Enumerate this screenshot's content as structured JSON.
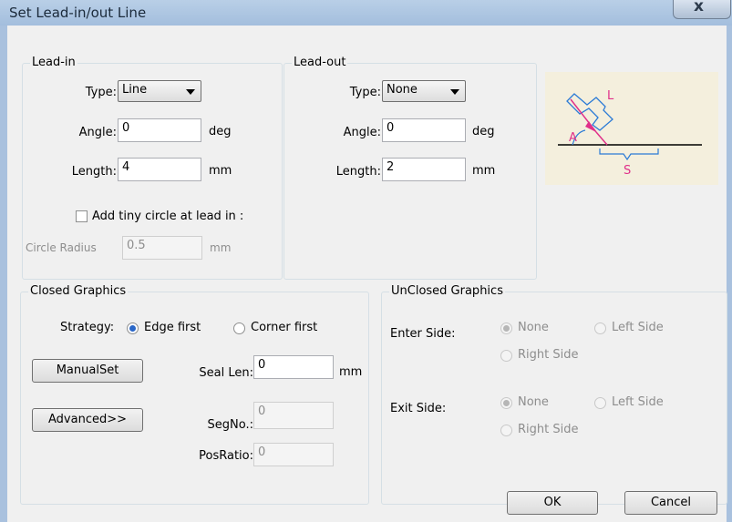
{
  "window": {
    "title": "Set Lead-in/out Line",
    "close_label": "x"
  },
  "lead_in": {
    "legend": "Lead-in",
    "type_label": "Type:",
    "type_value": "Line",
    "angle_label": "Angle:",
    "angle_value": "0",
    "angle_unit": "deg",
    "length_label": "Length:",
    "length_value": "4",
    "length_unit": "mm",
    "tiny_circle_label": "Add tiny circle at lead in :",
    "circle_radius_label": "Circle Radius",
    "circle_radius_value": "0.5",
    "circle_radius_unit": "mm"
  },
  "lead_out": {
    "legend": "Lead-out",
    "type_label": "Type:",
    "type_value": "None",
    "angle_label": "Angle:",
    "angle_value": "0",
    "angle_unit": "deg",
    "length_label": "Length:",
    "length_value": "2",
    "length_unit": "mm"
  },
  "diagram": {
    "label_l": "L",
    "label_a": "A",
    "label_s": "S",
    "accent_color": "#e0308a",
    "blue_color": "#2b7bd6"
  },
  "closed": {
    "legend": "Closed Graphics",
    "strategy_label": "Strategy:",
    "edge_first": "Edge first",
    "corner_first": "Corner first",
    "manualset_button": "ManualSet",
    "advanced_button": "Advanced>>",
    "seal_len_label": "Seal Len:",
    "seal_len_value": "0",
    "seal_len_unit": "mm",
    "segno_label": "SegNo.:",
    "segno_value": "0",
    "posratio_label": "PosRatio:",
    "posratio_value": "0"
  },
  "unclosed": {
    "legend": "UnClosed Graphics",
    "enter_side_label": "Enter Side:",
    "exit_side_label": "Exit Side:",
    "none": "None",
    "left_side": "Left Side",
    "right_side": "Right Side"
  },
  "buttons": {
    "ok": "OK",
    "cancel": "Cancel"
  }
}
